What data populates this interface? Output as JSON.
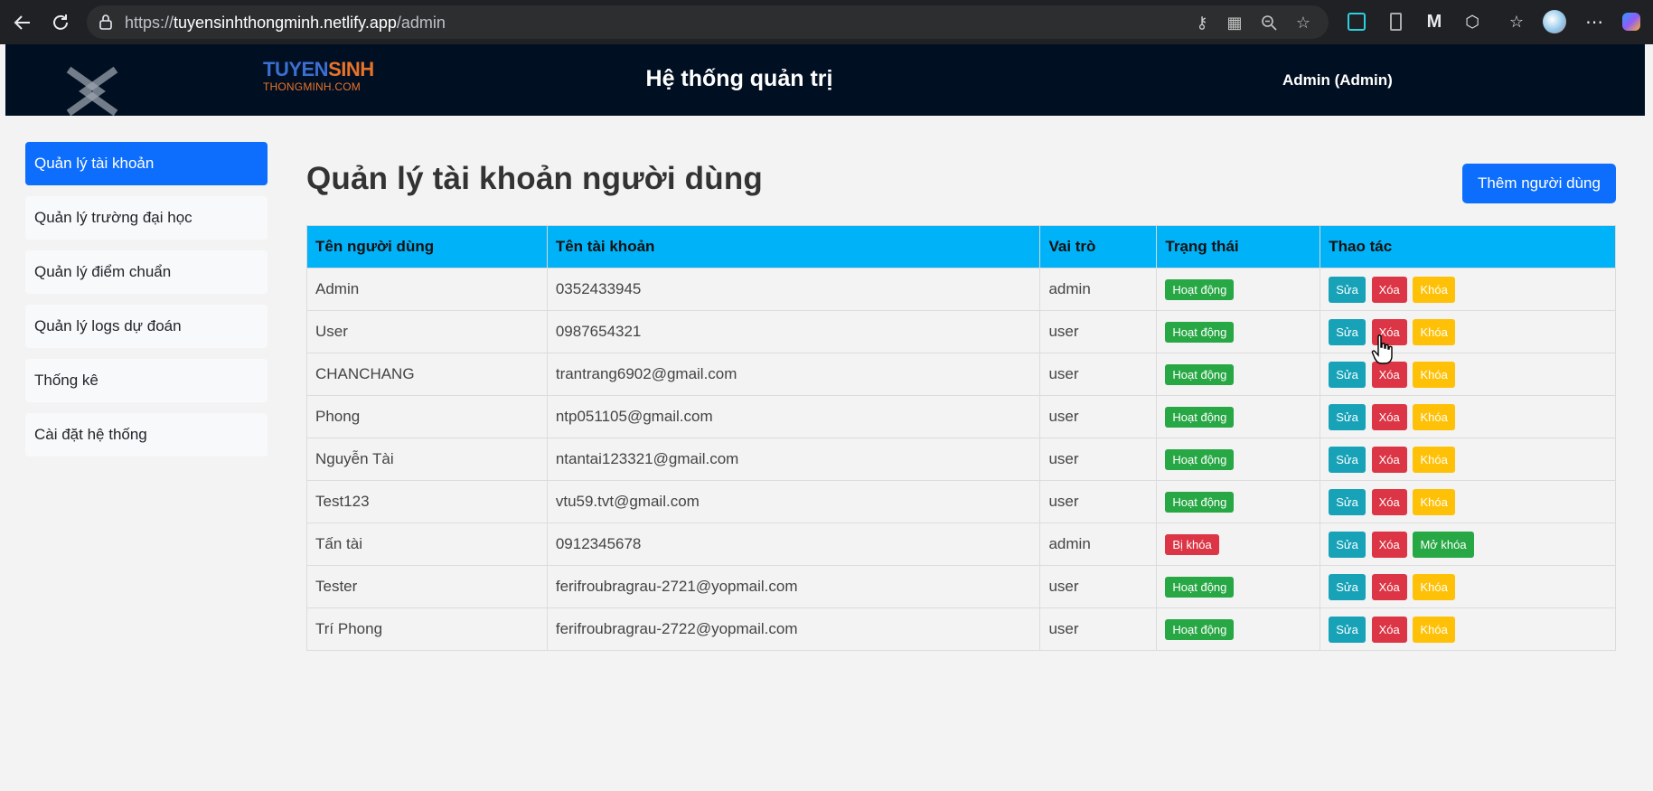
{
  "browser": {
    "url_prefix": "https://",
    "url_host": "tuyensinhthongminh.netlify.app",
    "url_path": "/admin"
  },
  "header": {
    "brand_part1": "TUYEN",
    "brand_part2": "SINH",
    "brand_sub": "THONGMINH.COM",
    "title": "Hệ thống quản trị",
    "user": "Admin (Admin)"
  },
  "sidebar": {
    "items": [
      {
        "label": "Quản lý tài khoản"
      },
      {
        "label": "Quản lý trường đại học"
      },
      {
        "label": "Quản lý điểm chuẩn"
      },
      {
        "label": "Quản lý logs dự đoán"
      },
      {
        "label": "Thống kê"
      },
      {
        "label": "Cài đặt hệ thống"
      }
    ]
  },
  "main": {
    "title": "Quản lý tài khoản người dùng",
    "add_button": "Thêm người dùng",
    "columns": [
      "Tên người dùng",
      "Tên tài khoản",
      "Vai trò",
      "Trạng thái",
      "Thao tác"
    ],
    "rows": [
      {
        "name": "Admin",
        "account": "0352433945",
        "role": "admin",
        "status": "Hoạt động",
        "edit": "Sửa",
        "delete": "Xóa",
        "lock": "Khóa"
      },
      {
        "name": "User",
        "account": "0987654321",
        "role": "user",
        "status": "Hoạt động",
        "edit": "Sửa",
        "delete": "Xóa",
        "lock": "Khóa"
      },
      {
        "name": "CHANCHANG",
        "account": "trantrang6902@gmail.com",
        "role": "user",
        "status": "Hoạt động",
        "edit": "Sửa",
        "delete": "Xóa",
        "lock": "Khóa"
      },
      {
        "name": "Phong",
        "account": "ntp051105@gmail.com",
        "role": "user",
        "status": "Hoạt động",
        "edit": "Sửa",
        "delete": "Xóa",
        "lock": "Khóa"
      },
      {
        "name": "Nguyễn Tài",
        "account": "ntantai123321@gmail.com",
        "role": "user",
        "status": "Hoạt động",
        "edit": "Sửa",
        "delete": "Xóa",
        "lock": "Khóa"
      },
      {
        "name": "Test123",
        "account": "vtu59.tvt@gmail.com",
        "role": "user",
        "status": "Hoạt động",
        "edit": "Sửa",
        "delete": "Xóa",
        "lock": "Khóa"
      },
      {
        "name": "Tấn tài",
        "account": "0912345678",
        "role": "admin",
        "status": "Bị khóa",
        "edit": "Sửa",
        "delete": "Xóa",
        "lock": "Mở khóa"
      },
      {
        "name": "Tester",
        "account": "ferifroubragrau-2721@yopmail.com",
        "role": "user",
        "status": "Hoạt động",
        "edit": "Sửa",
        "delete": "Xóa",
        "lock": "Khóa"
      },
      {
        "name": "Trí Phong",
        "account": "ferifroubragrau-2722@yopmail.com",
        "role": "user",
        "status": "Hoạt động",
        "edit": "Sửa",
        "delete": "Xóa",
        "lock": "Khóa"
      }
    ]
  },
  "colors": {
    "header_bg": "#010f22",
    "primary": "#0d6efd",
    "table_header": "#00b2f7",
    "status_active": "#28a745",
    "status_locked": "#dc3545",
    "edit": "#17a2b8",
    "delete": "#dc3545",
    "lock": "#ffc107"
  }
}
